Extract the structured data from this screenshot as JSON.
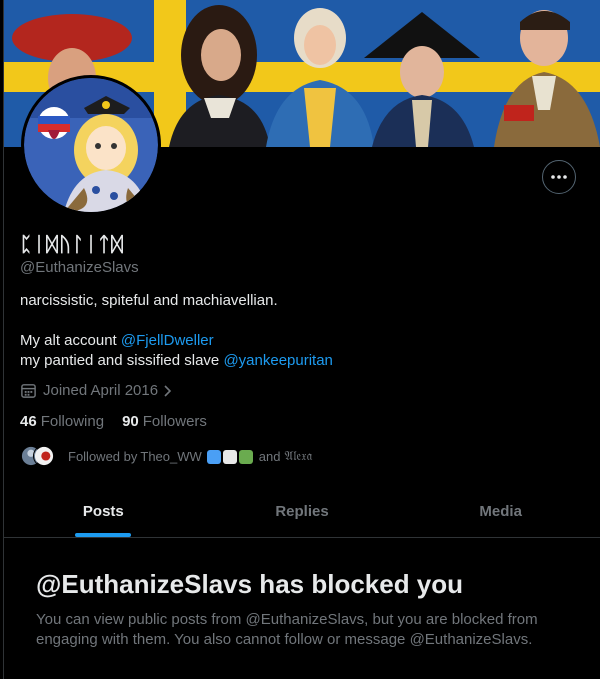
{
  "profile": {
    "display_name": "ᛈᛁᛞᚢᛚᛁᛏᛞ",
    "handle": "@EuthanizeSlavs",
    "bio": {
      "line1": "narcissistic, spiteful and machiavellian.",
      "alt_prefix": "My alt account ",
      "alt_mention": "@FjellDweller",
      "slave_prefix": "my pantied and sissified slave ",
      "slave_mention": "@yankeepuritan"
    },
    "joined": "Joined April 2016",
    "following_count": "46",
    "following_label": "Following",
    "followers_count": "90",
    "followers_label": "Followers"
  },
  "followed_by": {
    "prefix": "Followed by",
    "first": "Theo_WW",
    "and": "and",
    "second": "𝔄𝔩𝔢𝔵𝔞",
    "badge_colors": [
      "#4a9ff5",
      "#e8e8e8",
      "#6aab4f"
    ]
  },
  "tabs": [
    {
      "label": "Posts",
      "active": true
    },
    {
      "label": "Replies",
      "active": false
    },
    {
      "label": "Media",
      "active": false
    }
  ],
  "blocked": {
    "title": "@EuthanizeSlavs has blocked you",
    "message": "You can view public posts from @EuthanizeSlavs, but you are blocked from engaging with them. You also cannot follow or message @EuthanizeSlavs."
  },
  "colors": {
    "accent": "#1d9bf0",
    "text_primary": "#e7e9ea",
    "text_secondary": "#71767b",
    "background": "#000000",
    "banner_blue": "#1f5ba8",
    "banner_yellow": "#f2c81a"
  }
}
